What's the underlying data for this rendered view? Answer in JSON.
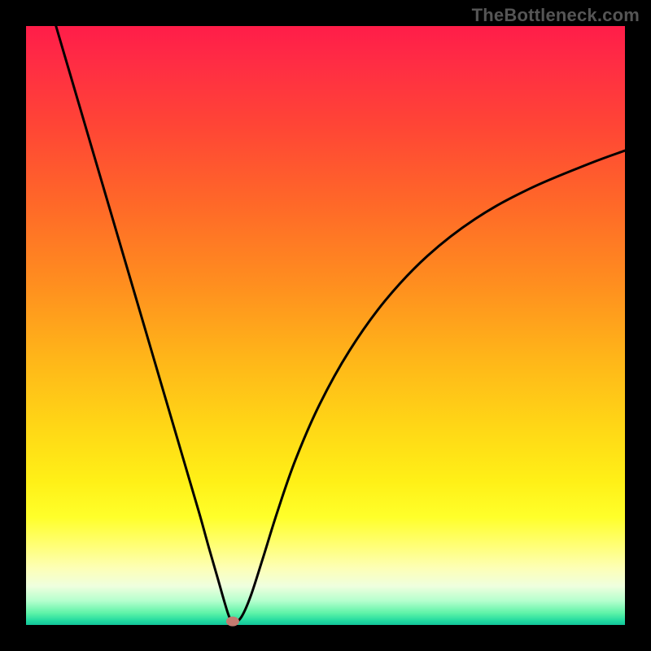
{
  "watermark": "TheBottleneck.com",
  "chart_data": {
    "type": "line",
    "title": "",
    "xlabel": "",
    "ylabel": "",
    "xlim": [
      0,
      100
    ],
    "ylim": [
      0,
      100
    ],
    "grid": false,
    "legend": false,
    "marker": {
      "x": 34.5,
      "y": 0.6
    },
    "series": [
      {
        "name": "bottleneck-curve",
        "x": [
          5.0,
          7.0,
          9.0,
          11.0,
          13.0,
          15.0,
          17.0,
          19.0,
          21.0,
          23.0,
          25.0,
          27.0,
          29.0,
          30.5,
          32.0,
          33.2,
          34.0,
          34.8,
          36.0,
          37.5,
          39.5,
          42.0,
          45.0,
          49.0,
          54.0,
          60.0,
          67.0,
          75.0,
          84.0,
          94.0,
          100.0
        ],
        "y": [
          100.0,
          93.2,
          86.4,
          79.6,
          72.8,
          66.0,
          59.2,
          52.4,
          45.6,
          38.8,
          32.0,
          25.2,
          18.4,
          13.0,
          7.8,
          3.6,
          1.2,
          0.4,
          1.4,
          4.8,
          11.0,
          19.0,
          27.6,
          36.8,
          45.8,
          54.2,
          61.6,
          67.8,
          72.8,
          77.0,
          79.2
        ]
      }
    ],
    "background_gradient": {
      "top": "#ff1d49",
      "mid": "#ffd716",
      "bottom": "#12c49a"
    }
  }
}
